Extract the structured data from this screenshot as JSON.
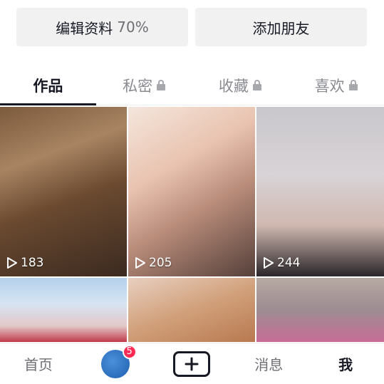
{
  "actions": {
    "edit_label": "编辑资料",
    "edit_progress": "70%",
    "add_friend_label": "添加朋友"
  },
  "tabs": [
    {
      "label": "作品",
      "locked": false,
      "active": true
    },
    {
      "label": "私密",
      "locked": true,
      "active": false
    },
    {
      "label": "收藏",
      "locked": true,
      "active": false
    },
    {
      "label": "喜欢",
      "locked": true,
      "active": false
    }
  ],
  "videos": [
    {
      "views": "183",
      "thumb": "girl-eating"
    },
    {
      "views": "205",
      "thumb": "man-selfie"
    },
    {
      "views": "244",
      "thumb": "boy-portrait"
    },
    {
      "views": "",
      "thumb": "girls-group"
    },
    {
      "views": "",
      "thumb": "food-closeup"
    },
    {
      "views": "",
      "thumb": "girl-outdoor"
    }
  ],
  "bottom_nav": {
    "home": "首页",
    "badge_count": "5",
    "messages": "消息",
    "me": "我"
  },
  "colors": {
    "badge": "#fe2c55",
    "text": "#161823",
    "button_bg": "#f1f1f2"
  }
}
